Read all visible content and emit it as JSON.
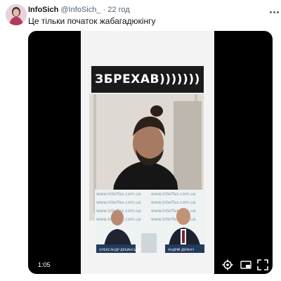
{
  "tweet": {
    "author_name": "InfoSich",
    "handle": "@InfoSich_",
    "separator": "·",
    "timestamp": "22 год",
    "text": "Це тільки початок жабагадюкінгу"
  },
  "video": {
    "caption": "ЗБРЕХАВ)))))))",
    "elapsed": "1:05",
    "watermark": "www.interfax.com.ua",
    "nameplate_left": "ОЛЕКСАНДР ДУБИНСЬКИЙ",
    "nameplate_right": "АНДРІЙ ДЕРКАЧ"
  },
  "icons": {
    "more": "more-dots-icon",
    "settings": "settings-gear-icon",
    "pip": "picture-in-picture-icon",
    "fullscreen": "fullscreen-icon"
  },
  "colors": {
    "text_primary": "#0f1419",
    "text_secondary": "#536471",
    "media_background": "#000000",
    "caption_background": "#1a1a1a"
  }
}
